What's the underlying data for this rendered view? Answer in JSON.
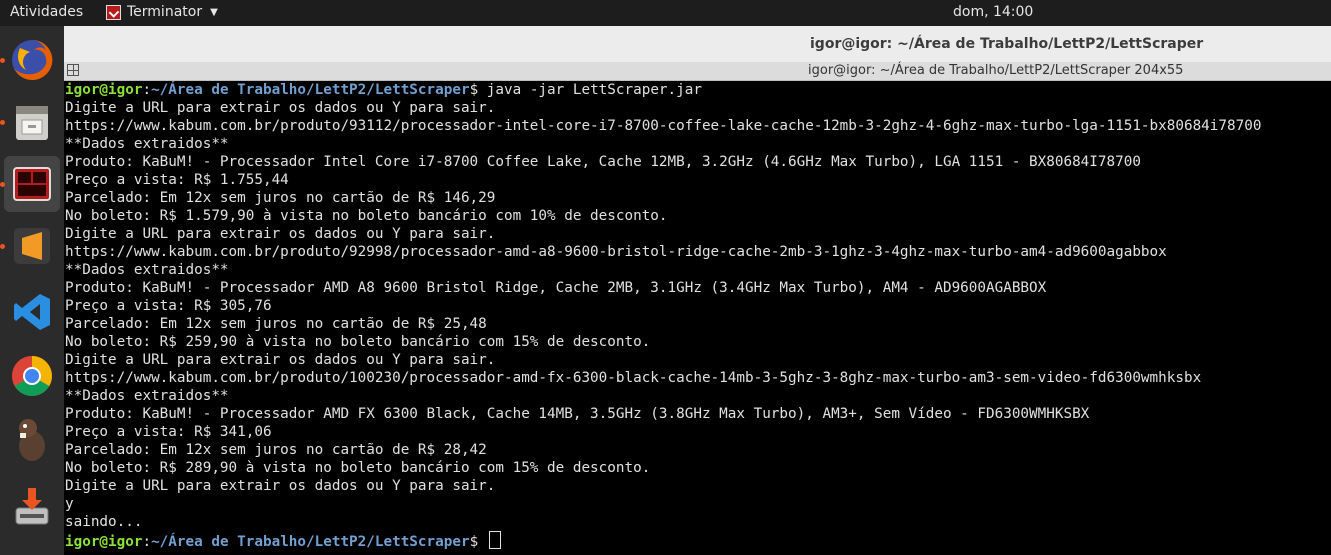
{
  "topbar": {
    "activities": "Atividades",
    "app_name": "Terminator",
    "clock": "dom, 14:00"
  },
  "dock": {
    "apps": [
      {
        "name": "firefox-icon",
        "color": "#e66000"
      },
      {
        "name": "files-icon",
        "color": "#d0cfc9"
      },
      {
        "name": "terminator-icon",
        "color": "#b51b1b"
      },
      {
        "name": "sublime-text-icon",
        "color": "#f19a25"
      },
      {
        "name": "vscode-icon",
        "color": "#2a8fe0"
      },
      {
        "name": "chrome-icon",
        "color": "#db4437"
      },
      {
        "name": "beaver-icon",
        "color": "#5a4030"
      },
      {
        "name": "installer-icon",
        "color": "#c0c0c0"
      }
    ]
  },
  "window": {
    "title": "igor@igor: ~/Área de Trabalho/LettP2/LettScraper",
    "subtitle": "igor@igor: ~/Área de Trabalho/LettP2/LettScraper 204x55"
  },
  "terminal": {
    "prompt_user": "igor@igor",
    "prompt_sep": ":",
    "prompt_path": "~/Área de Trabalho/LettP2/LettScraper",
    "prompt_symbol": "$",
    "command": " java -jar LettScraper.jar",
    "lines": [
      "Digite a URL para extrair os dados ou Y para sair.",
      "https://www.kabum.com.br/produto/93112/processador-intel-core-i7-8700-coffee-lake-cache-12mb-3-2ghz-4-6ghz-max-turbo-lga-1151-bx80684i78700",
      "**Dados extraidos**",
      "Produto: KaBuM! - Processador Intel Core i7-8700 Coffee Lake, Cache 12MB, 3.2GHz (4.6GHz Max Turbo), LGA 1151 - BX80684I78700",
      "Preço a vista: R$ 1.755,44",
      "Parcelado: Em 12x sem juros no cartão de R$ 146,29",
      "No boleto: R$ 1.579,90 à vista no boleto bancário com 10% de desconto.",
      "Digite a URL para extrair os dados ou Y para sair.",
      "https://www.kabum.com.br/produto/92998/processador-amd-a8-9600-bristol-ridge-cache-2mb-3-1ghz-3-4ghz-max-turbo-am4-ad9600agabbox",
      "**Dados extraidos**",
      "Produto: KaBuM! - Processador AMD A8 9600 Bristol Ridge, Cache 2MB, 3.1GHz (3.4GHz Max Turbo), AM4 - AD9600AGABBOX",
      "Preço a vista: R$ 305,76",
      "Parcelado: Em 12x sem juros no cartão de R$ 25,48",
      "No boleto: R$ 259,90 à vista no boleto bancário com 15% de desconto.",
      "Digite a URL para extrair os dados ou Y para sair.",
      "https://www.kabum.com.br/produto/100230/processador-amd-fx-6300-black-cache-14mb-3-5ghz-3-8ghz-max-turbo-am3-sem-video-fd6300wmhksbx",
      "**Dados extraidos**",
      "Produto: KaBuM! - Processador AMD FX 6300 Black, Cache 14MB, 3.5GHz (3.8GHz Max Turbo), AM3+, Sem Vídeo - FD6300WMHKSBX",
      "Preço a vista: R$ 341,06",
      "Parcelado: Em 12x sem juros no cartão de R$ 28,42",
      "No boleto: R$ 289,90 à vista no boleto bancário com 15% de desconto.",
      "Digite a URL para extrair os dados ou Y para sair.",
      "y",
      "saindo..."
    ]
  }
}
